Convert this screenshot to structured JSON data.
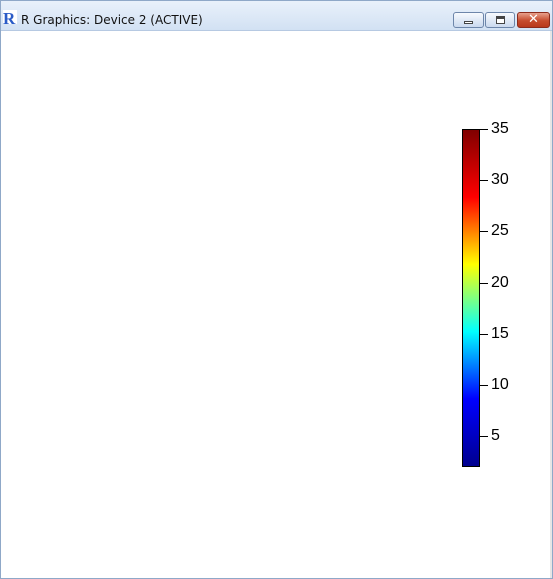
{
  "window": {
    "title": "R Graphics: Device 2 (ACTIVE)",
    "app_icon": "r-logo-icon",
    "buttons": {
      "minimize_icon": "minimize-icon",
      "maximize_icon": "maximize-icon",
      "close_icon": "close-icon",
      "close_glyph": "✕"
    }
  },
  "chart_data": {
    "type": "heatmap",
    "colorbar": {
      "min": 2,
      "max": 35,
      "ticks": [
        5,
        10,
        15,
        20,
        25,
        30,
        35
      ],
      "tick_labels": [
        "5",
        "10",
        "15",
        "20",
        "25",
        "30",
        "35"
      ],
      "colormap": [
        "#00008f",
        "#0000ff",
        "#00ffff",
        "#ffff00",
        "#ff0000",
        "#800000"
      ]
    }
  }
}
